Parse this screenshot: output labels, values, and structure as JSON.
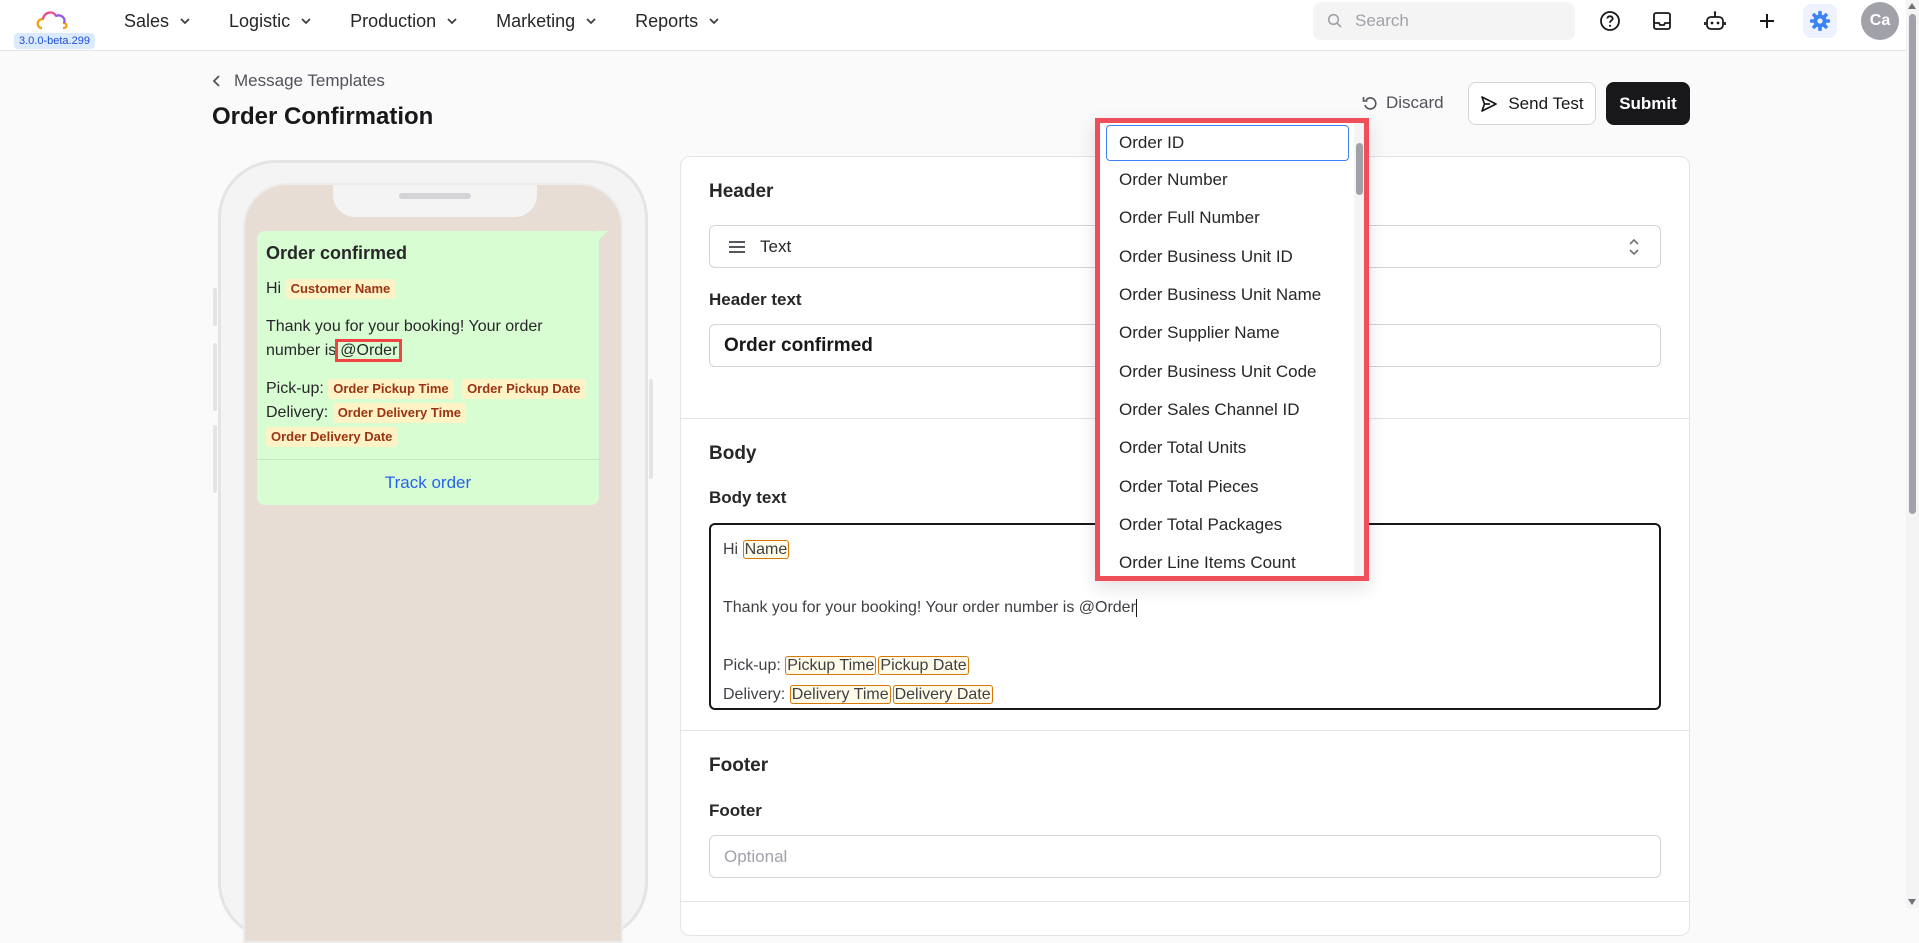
{
  "app": {
    "version": "3.0.0-beta.299",
    "user_initials": "Ca"
  },
  "nav": {
    "menu": [
      {
        "label": "Sales"
      },
      {
        "label": "Logistic"
      },
      {
        "label": "Production"
      },
      {
        "label": "Marketing"
      },
      {
        "label": "Reports"
      }
    ],
    "search_placeholder": "Search"
  },
  "page": {
    "breadcrumb": "Message Templates",
    "title": "Order Confirmation",
    "discard_label": "Discard",
    "send_test_label": "Send Test",
    "submit_label": "Submit"
  },
  "preview": {
    "title": "Order confirmed",
    "greeting": "Hi",
    "greeting_var": "Customer Name",
    "body_text": "Thank you for your booking! Your order number is",
    "body_mention": "@Order",
    "pickup_label": "Pick-up:",
    "pickup_vars": [
      "Order Pickup Time",
      "Order Pickup Date"
    ],
    "delivery_label": "Delivery:",
    "delivery_vars": [
      "Order Delivery Time",
      "Order Delivery Date"
    ],
    "button_label": "Track order"
  },
  "form": {
    "header_section": "Header",
    "header_type_value": "Text",
    "header_text_label": "Header text",
    "header_text_value": "Order confirmed",
    "body_section": "Body",
    "body_text_label": "Body text",
    "body": {
      "greeting": "Hi",
      "greeting_var": "Name",
      "line2": "Thank you for your booking! Your order number is @Order",
      "pickup_label": "Pick-up:",
      "pickup_vars": [
        "Pickup Time",
        "Pickup Date"
      ],
      "delivery_label": "Delivery:",
      "delivery_vars": [
        "Delivery Time",
        "Delivery Date"
      ]
    },
    "footer_section": "Footer",
    "footer_label": "Footer",
    "footer_placeholder": "Optional"
  },
  "dropdown": {
    "items": [
      "Order ID",
      "Order Number",
      "Order Full Number",
      "Order Business Unit ID",
      "Order Business Unit Name",
      "Order Supplier Name",
      "Order Business Unit Code",
      "Order Sales Channel ID",
      "Order Total Units",
      "Order Total Pieces",
      "Order Total Packages",
      "Order Line Items Count"
    ],
    "selected_index": 0
  },
  "colors": {
    "accent_blue": "#2563eb",
    "highlight_red": "#ef4f5a",
    "bubble_green": "#d9fdd3",
    "chat_background": "#e7ddd4"
  }
}
